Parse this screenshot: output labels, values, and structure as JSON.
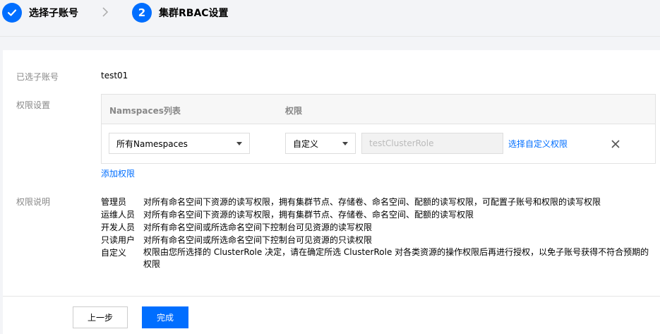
{
  "steps": [
    {
      "label": "选择子账号",
      "state": "done"
    },
    {
      "label": "集群RBAC设置",
      "number": "2",
      "state": "active"
    }
  ],
  "form": {
    "selected_account_label": "已选子账号",
    "selected_account_value": "test01",
    "permission_label": "权限设置",
    "table": {
      "col_namespaces": "Namspaces列表",
      "col_permission": "权限",
      "namespace_select": "所有Namespaces",
      "permission_select": "自定义",
      "cluster_role_placeholder": "testClusterRole",
      "choose_custom_link": "选择自定义权限"
    },
    "add_permission_link": "添加权限",
    "description_label": "权限说明",
    "descriptions": [
      {
        "role": "管理员",
        "text": "对所有命名空间下资源的读写权限，拥有集群节点、存储卷、命名空间、配额的读写权限，可配置子账号和权限的读写权限"
      },
      {
        "role": "运维人员",
        "text": "对所有命名空间下资源的读写权限，拥有集群节点、存储卷、命名空间、配额的读写权限"
      },
      {
        "role": "开发人员",
        "text": "对所有命名空间或所选命名空间下控制台可见资源的读写权限"
      },
      {
        "role": "只读用户",
        "text": "对所有命名空间或所选命名空间下控制台可见资源的只读权限"
      },
      {
        "role": "自定义",
        "text": "权限由您所选择的 ClusterRole 决定，请在确定所选 ClusterRole 对各类资源的操作权限后再进行授权，以免子账号获得不符合预期的权限"
      }
    ]
  },
  "footer": {
    "prev_label": "上一步",
    "finish_label": "完成"
  },
  "colors": {
    "accent": "#006eff"
  }
}
